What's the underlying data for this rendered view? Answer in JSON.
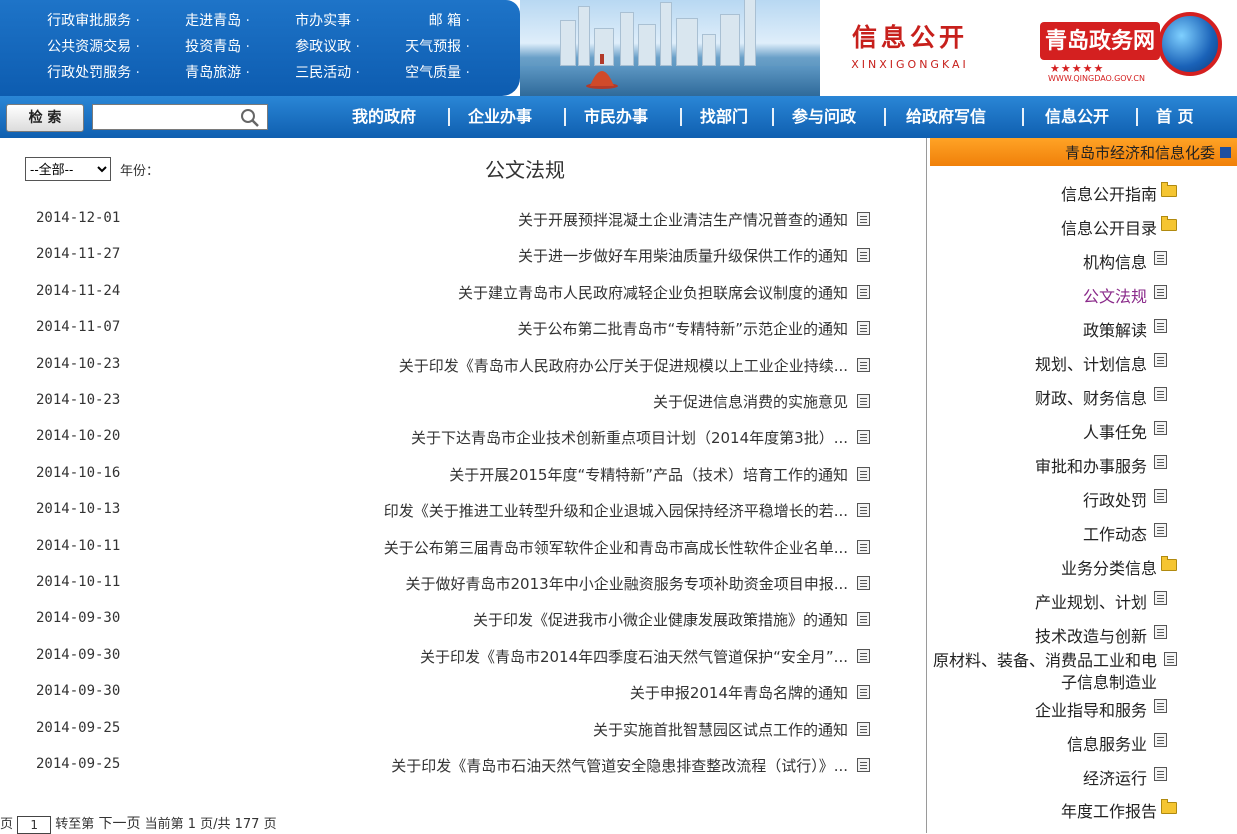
{
  "header": {
    "quick_links": [
      [
        "行政审批服务",
        "走进青岛",
        "市办实事",
        "邮 箱"
      ],
      [
        "公共资源交易",
        "投资青岛",
        "参政议政",
        "天气预报"
      ],
      [
        "行政处罚服务",
        "青岛旅游",
        "三民活动",
        "空气质量"
      ]
    ],
    "slogan": "信息公开",
    "slogan_pinyin": "XINXIGONGKAI",
    "logo_text": "青岛政务网",
    "logo_domain": "WWW.QINGDAO.GOV.CN",
    "logo_stars": "★★★★★"
  },
  "nav": {
    "search_button": "检 索",
    "search_placeholder": "",
    "items": [
      "首 页",
      "信息公开",
      "给政府写信",
      "参与问政",
      "找部门",
      "市民办事",
      "企业办事",
      "我的政府"
    ]
  },
  "main": {
    "title": "公文法规",
    "year_label": "年份：",
    "year_selected": "--全部--",
    "documents": [
      {
        "title": "关于开展预拌混凝土企业清洁生产情况普查的通知",
        "date": "2014-12-01"
      },
      {
        "title": "关于进一步做好车用柴油质量升级保供工作的通知",
        "date": "2014-11-27"
      },
      {
        "title": "关于建立青岛市人民政府减轻企业负担联席会议制度的通知",
        "date": "2014-11-24"
      },
      {
        "title": "关于公布第二批青岛市“专精特新”示范企业的通知",
        "date": "2014-11-07"
      },
      {
        "title": "关于印发《青岛市人民政府办公厅关于促进规模以上工业企业持续...",
        "date": "2014-10-23"
      },
      {
        "title": "关于促进信息消费的实施意见",
        "date": "2014-10-23"
      },
      {
        "title": "关于下达青岛市企业技术创新重点项目计划（2014年度第3批）...",
        "date": "2014-10-20"
      },
      {
        "title": "关于开展2015年度“专精特新”产品（技术）培育工作的通知",
        "date": "2014-10-16"
      },
      {
        "title": "印发《关于推进工业转型升级和企业退城入园保持经济平稳增长的若...",
        "date": "2014-10-13"
      },
      {
        "title": "关于公布第三届青岛市领军软件企业和青岛市高成长性软件企业名单...",
        "date": "2014-10-11"
      },
      {
        "title": "关于做好青岛市2013年中小企业融资服务专项补助资金项目申报...",
        "date": "2014-10-11"
      },
      {
        "title": "关于印发《促进我市小微企业健康发展政策措施》的通知",
        "date": "2014-09-30"
      },
      {
        "title": "关于印发《青岛市2014年四季度石油天然气管道保护“安全月”...",
        "date": "2014-09-30"
      },
      {
        "title": "关于申报2014年青岛名牌的通知",
        "date": "2014-09-30"
      },
      {
        "title": "关于实施首批智慧园区试点工作的通知",
        "date": "2014-09-25"
      },
      {
        "title": "关于印发《青岛市石油天然气管道安全隐患排查整改流程（试行）》...",
        "date": "2014-09-25"
      }
    ],
    "pager": {
      "summary": "当前第 1 页/共 177 页",
      "next": "下一页",
      "goto_prefix": "转至第",
      "goto_value": "1",
      "goto_suffix": "页"
    }
  },
  "sidebar": {
    "title": "青岛市经济和信息化委",
    "items": [
      {
        "label": "信息公开指南",
        "icon": "folder-icon",
        "level": 0
      },
      {
        "label": "信息公开目录",
        "icon": "folder-icon",
        "level": 0
      },
      {
        "label": "机构信息",
        "icon": "page-icon",
        "level": 1
      },
      {
        "label": "公文法规",
        "icon": "page-icon",
        "level": 1,
        "active": true
      },
      {
        "label": "政策解读",
        "icon": "page-icon",
        "level": 1
      },
      {
        "label": "规划、计划信息",
        "icon": "page-icon",
        "level": 1
      },
      {
        "label": "财政、财务信息",
        "icon": "page-icon",
        "level": 1
      },
      {
        "label": "人事任免",
        "icon": "page-icon",
        "level": 1
      },
      {
        "label": "审批和办事服务",
        "icon": "page-icon",
        "level": 1
      },
      {
        "label": "行政处罚",
        "icon": "page-icon",
        "level": 1
      },
      {
        "label": "工作动态",
        "icon": "page-icon",
        "level": 1
      },
      {
        "label": "业务分类信息",
        "icon": "folder-icon",
        "level": 0
      },
      {
        "label": "产业规划、计划",
        "icon": "page-icon",
        "level": 1
      },
      {
        "label": "技术改造与创新",
        "icon": "page-icon",
        "level": 1
      },
      {
        "label": "原材料、装备、消费品工业和电子信息制造业",
        "icon": "page-icon",
        "level": 1
      },
      {
        "label": "企业指导和服务",
        "icon": "page-icon",
        "level": 1
      },
      {
        "label": "信息服务业",
        "icon": "page-icon",
        "level": 1
      },
      {
        "label": "经济运行",
        "icon": "page-icon",
        "level": 1
      },
      {
        "label": "年度工作报告",
        "icon": "folder-icon",
        "level": 0
      }
    ]
  }
}
